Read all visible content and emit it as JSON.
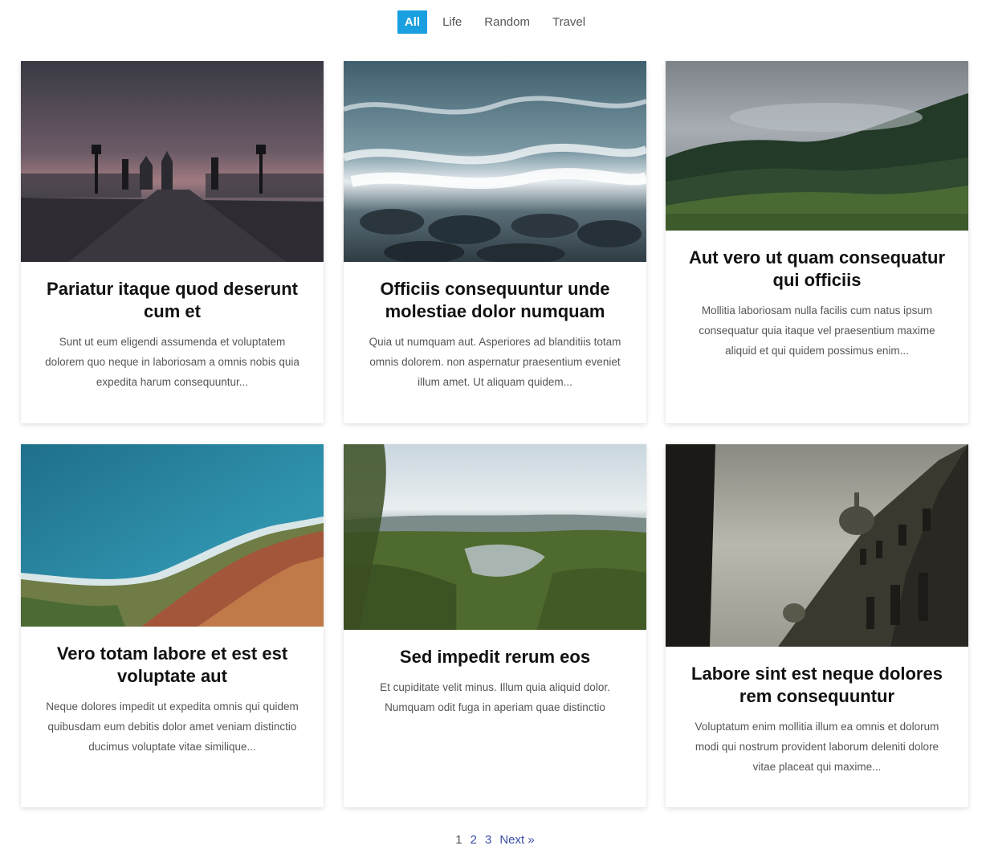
{
  "filters": [
    {
      "label": "All",
      "active": true
    },
    {
      "label": "Life",
      "active": false
    },
    {
      "label": "Random",
      "active": false
    },
    {
      "label": "Travel",
      "active": false
    }
  ],
  "posts": [
    {
      "title": "Pariatur itaque quod deserunt cum et",
      "excerpt": "Sunt ut eum eligendi assumenda et voluptatem dolorem quo neque in laboriosam a omnis nobis quia expedita harum consequuntur...",
      "image": "bridge-silhouette-photo"
    },
    {
      "title": "Officiis consequuntur unde molestiae dolor numquam",
      "excerpt": "Quia ut numquam aut. Asperiores ad blanditiis totam omnis dolorem. non aspernatur praesentium eveniet illum amet. Ut aliquam quidem...",
      "image": "ocean-waves-rocks-photo"
    },
    {
      "title": "Aut vero ut quam consequatur qui officiis",
      "excerpt": "Mollitia laboriosam nulla facilis cum natus ipsum consequatur quia itaque vel praesentium maxime aliquid et qui quidem possimus enim...",
      "image": "misty-forest-hill-photo"
    },
    {
      "title": "Vero totam labore et est est voluptate aut",
      "excerpt": "Neque dolores impedit ut expedita omnis qui quidem quibusdam eum debitis dolor amet veniam distinctio ducimus voluptate vitae similique...",
      "image": "aerial-coastline-photo"
    },
    {
      "title": "Sed impedit rerum eos",
      "excerpt": "Et cupiditate velit minus. Illum quia aliquid dolor. Numquam odit fuga in aperiam quae distinctio",
      "image": "jungle-lake-valley-photo"
    },
    {
      "title": "Labore sint est neque dolores rem consequuntur",
      "excerpt": "Voluptatum enim mollitia illum ea omnis et dolorum modi qui nostrum provident laborum deleniti dolore vitae placeat qui maxime...",
      "image": "baroque-building-dome-photo"
    }
  ],
  "pagination": {
    "pages": [
      "1",
      "2",
      "3"
    ],
    "current": "1",
    "next_label": "Next »"
  }
}
